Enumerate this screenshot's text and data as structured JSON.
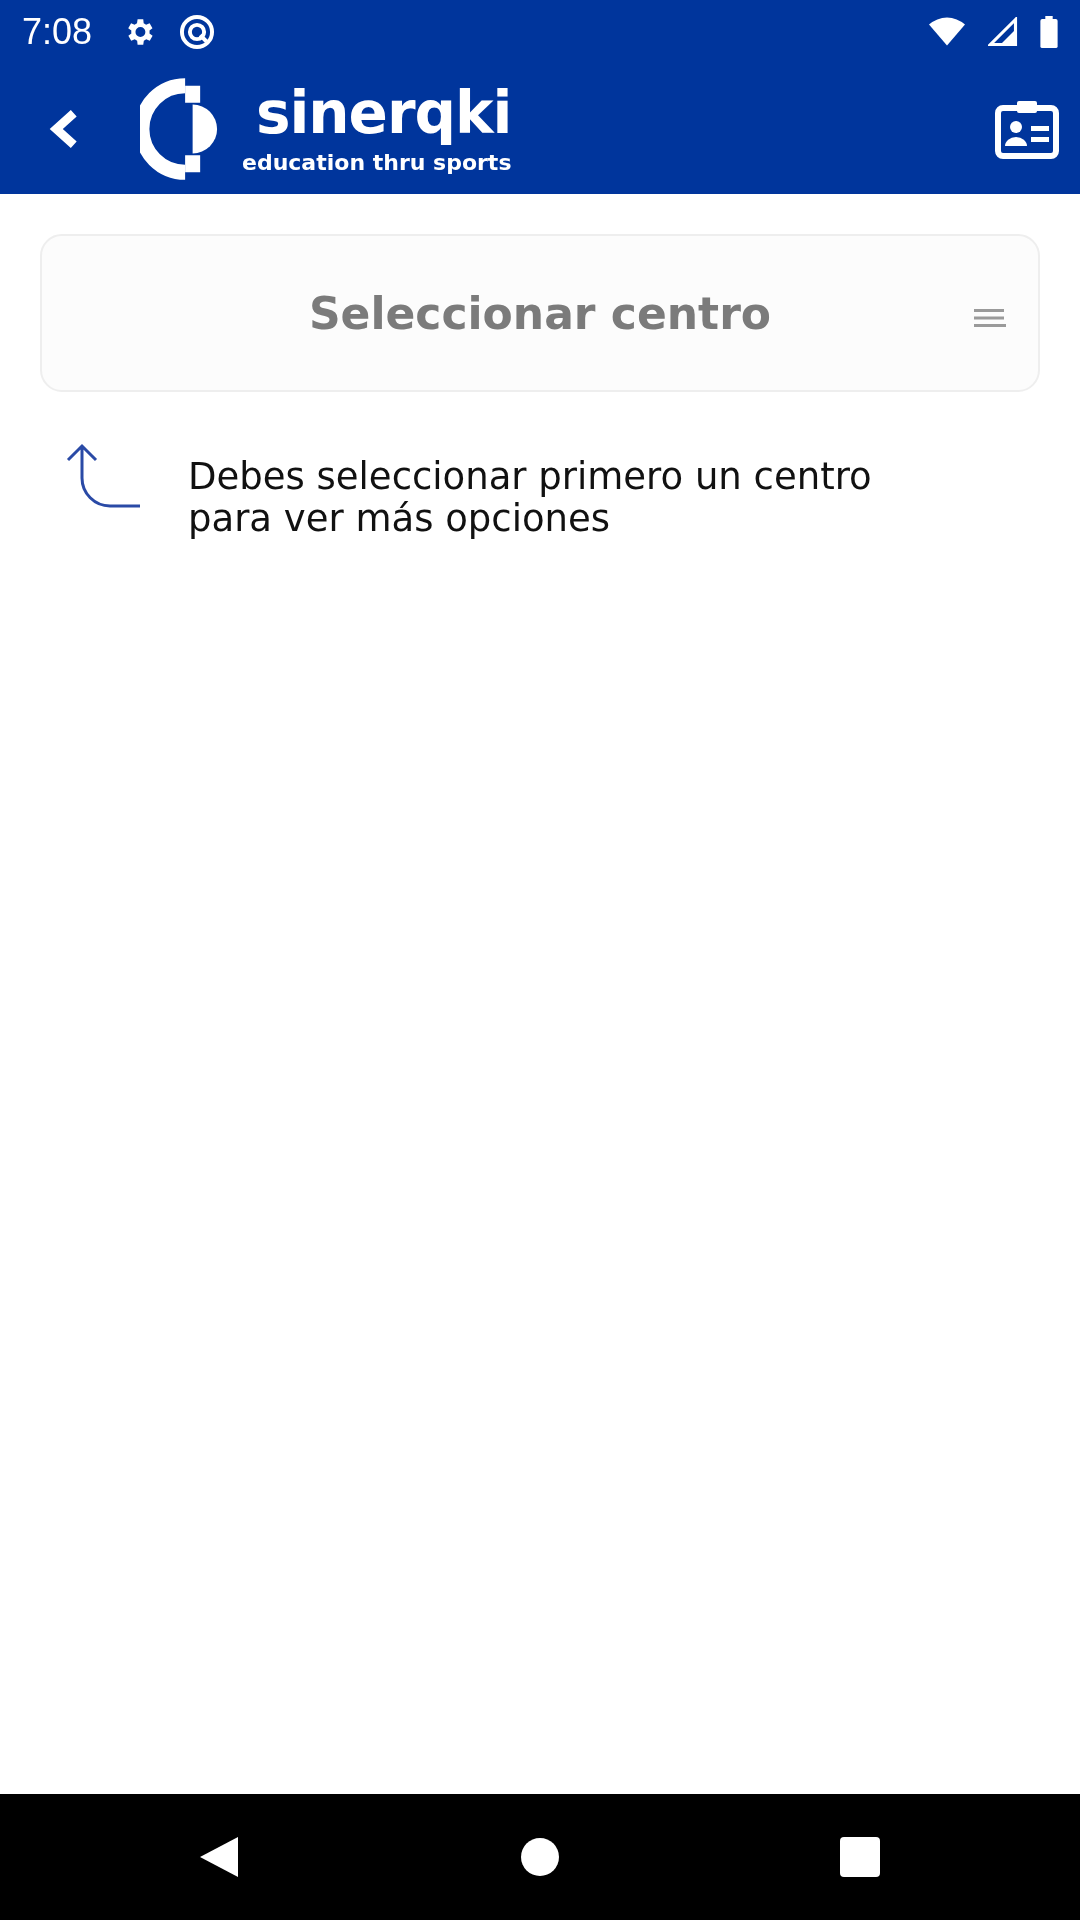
{
  "status_bar": {
    "time": "7:08"
  },
  "app_bar": {
    "logo_name": "sinerqki",
    "logo_tagline": "education thru sports"
  },
  "center_selector": {
    "placeholder": "Seleccionar centro"
  },
  "hint": {
    "text": "Debes seleccionar primero un centro para ver más opciones"
  }
}
